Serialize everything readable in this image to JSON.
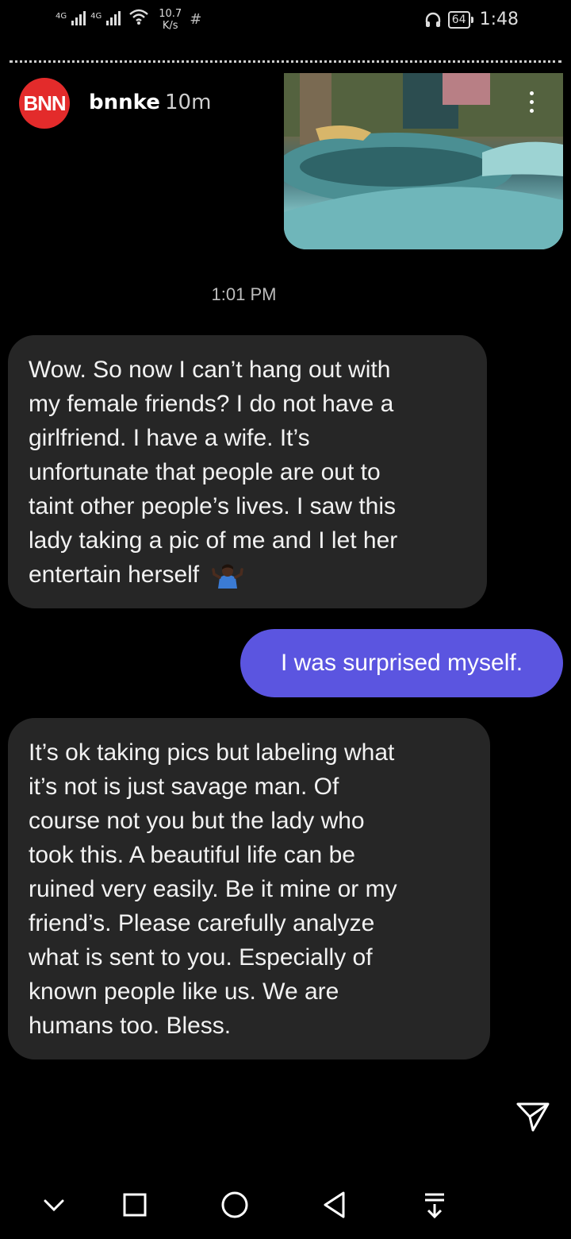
{
  "status_bar": {
    "network1": "4G",
    "network2": "4G",
    "speed_value": "10.7",
    "speed_unit": "K/s",
    "battery": "64",
    "time": "1:48"
  },
  "header": {
    "avatar_text": "BNN",
    "username": "bnnke",
    "time_ago": "10m"
  },
  "conversation": {
    "timestamp": "1:01 PM",
    "messages": [
      {
        "direction": "incoming",
        "lines": [
          "Wow. So now I can’t hang out with",
          "my female friends? I do not have a",
          "girlfriend. I have a wife. It’s",
          "unfortunate that people are out to",
          "taint other people’s lives. I saw this",
          "lady taking a pic of me and I let her",
          "entertain herself"
        ],
        "trailing_emoji": "person-shrugging-emoji"
      },
      {
        "direction": "outgoing",
        "text": "I was surprised myself."
      },
      {
        "direction": "incoming",
        "lines": [
          "It’s ok taking pics but labeling what",
          "it’s not is just savage man. Of",
          "course not you but the lady who",
          "took this. A beautiful life can be",
          "ruined very easily. Be it mine or my",
          "friend’s. Please carefully analyze",
          "what is sent to you. Especially of",
          "known people like us. We are",
          "humans too. Bless."
        ]
      }
    ]
  },
  "icons": {
    "more": "more-vertical-icon",
    "send": "send-icon",
    "nav": [
      "chevron-down-icon",
      "square-icon",
      "circle-icon",
      "back-triangle-icon",
      "download-icon"
    ]
  },
  "colors": {
    "background": "#000000",
    "incoming_bubble": "#262626",
    "outgoing_bubble": "#5b55e0",
    "avatar": "#e32b2b"
  }
}
